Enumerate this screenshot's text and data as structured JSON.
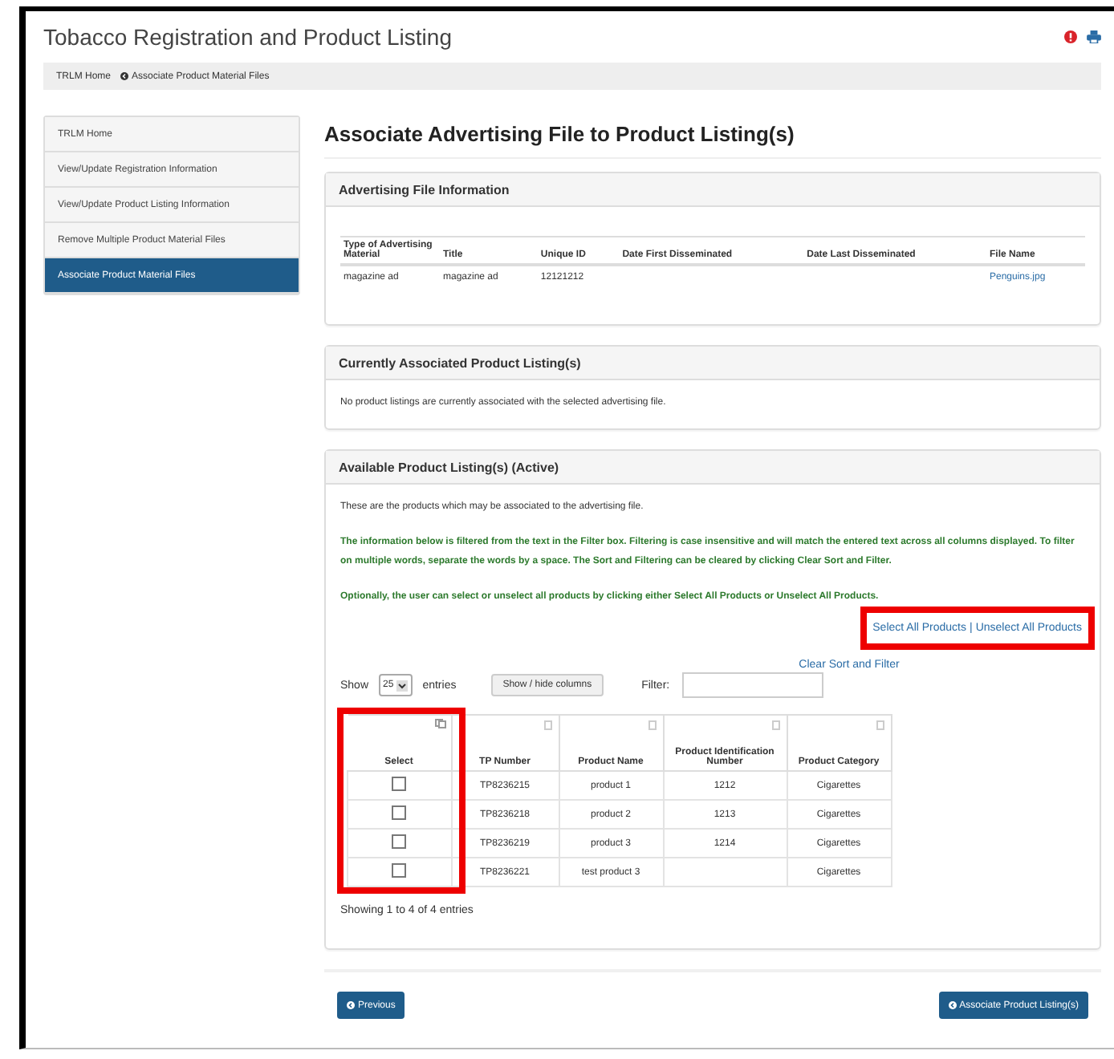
{
  "app_title": "Tobacco Registration and Product Listing",
  "breadcrumb": [
    {
      "label": "TRLM Home",
      "kind": "link"
    },
    {
      "label": "Associate Product Material Files",
      "kind": "current"
    }
  ],
  "sidebar": {
    "items": [
      {
        "label": "TRLM Home",
        "selected": false
      },
      {
        "label": "View/Update Registration Information",
        "selected": false
      },
      {
        "label": "View/Update Product Listing Information",
        "selected": false
      },
      {
        "label": "Remove Multiple Product Material Files",
        "selected": false
      },
      {
        "label": "Associate Product Material Files",
        "selected": true
      }
    ]
  },
  "page_heading": "Associate Advertising File to Product Listing(s)",
  "advertising_file": {
    "title": "Advertising File Information",
    "columns": [
      "Type of Advertising Material",
      "Title",
      "Unique ID",
      "Date First Disseminated",
      "Date Last Disseminated",
      "File Name"
    ],
    "rows": [
      [
        "magazine ad",
        "magazine ad",
        "12121212",
        "",
        "",
        "Penguins.jpg"
      ]
    ]
  },
  "current_listings": {
    "title": "Currently Associated Product Listing(s)",
    "message": "No product listings are currently associated with the selected advertising file."
  },
  "available": {
    "title": "Available Product Listing(s) (Active)",
    "intro": "These are the products which may be associated to the advertising file.",
    "filter_help": "The information below is filtered from the text in the Filter box. Filtering is case insensitive and will match the entered text across all columns displayed. To filter on multiple words, separate the words by a space. The Sort and Filtering can be cleared by clicking Clear Sort and Filter.",
    "optional_note": "Optionally, the user can select or unselect all products by clicking either Select All Products or Unselect All Products.",
    "select_links": {
      "highlighted": true,
      "select_all": "Select All Products",
      "separator": "|",
      "unselect_all": "Unselect All Products"
    },
    "clear_sort": "Clear Sort and Filter",
    "show_label": "Show",
    "page_size": "25",
    "entries_label": "entries",
    "show_hide_button": "Show / hide columns",
    "filter_label": "Filter:",
    "select_column_highlighted": true,
    "columns": [
      "Select",
      "TP Number",
      "Product Name",
      "Product Identification Number",
      "Product Category"
    ],
    "rows": [
      {
        "cells": [
          {
            "kind": "checkbox",
            "checked": false
          },
          "TP8236215",
          "product 1",
          "1212",
          "Cigarettes"
        ]
      },
      {
        "cells": [
          {
            "kind": "checkbox",
            "checked": false
          },
          "TP8236218",
          "product 2",
          "1213",
          "Cigarettes"
        ]
      },
      {
        "cells": [
          {
            "kind": "checkbox",
            "checked": false
          },
          "TP8236219",
          "product 3",
          "1214",
          "Cigarettes"
        ]
      },
      {
        "cells": [
          {
            "kind": "checkbox",
            "checked": false
          },
          "TP8236221",
          "test product 3",
          "",
          "Cigarettes"
        ]
      }
    ],
    "footer": "Showing 1 to 4 of 4 entries"
  },
  "buttons": {
    "previous": "Previous",
    "associate": "Associate Product Listing(s)"
  }
}
